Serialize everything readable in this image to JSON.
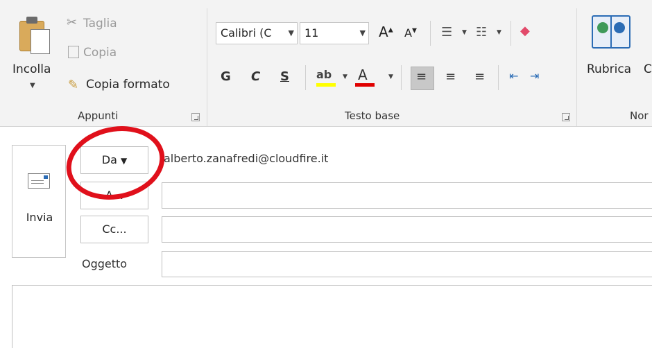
{
  "ribbon": {
    "clipboard": {
      "paste_label": "Incolla",
      "cut_label": "Taglia",
      "copy_label": "Copia",
      "format_painter_label": "Copia formato",
      "group_label": "Appunti"
    },
    "basic_text": {
      "font_name": "Calibri (C",
      "font_size": "11",
      "bold": "G",
      "italic": "C",
      "underline": "S",
      "group_label": "Testo base"
    },
    "names": {
      "address_book_label": "Rubrica",
      "check_names_partial": "C",
      "group_label_partial": "Nor"
    }
  },
  "message": {
    "send_label": "Invia",
    "from_label": "Da",
    "from_value": "alberto.zanafredi@cloudfire.it",
    "to_label": "A...",
    "cc_label": "Cc...",
    "subject_label": "Oggetto"
  },
  "colors": {
    "highlight": "#ffff00",
    "font_color": "#e00000",
    "annotation": "#e0101b"
  }
}
